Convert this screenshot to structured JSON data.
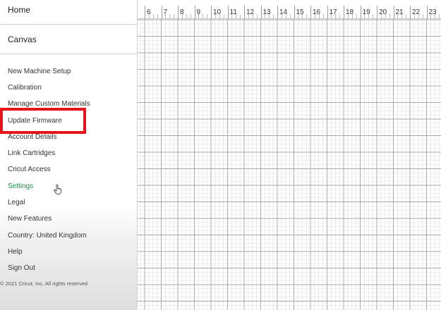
{
  "sidebar": {
    "home": "Home",
    "canvas": "Canvas",
    "items": [
      {
        "label": "New Machine Setup"
      },
      {
        "label": "Calibration"
      },
      {
        "label": "Manage Custom Materials"
      },
      {
        "label": "Update Firmware"
      },
      {
        "label": "Account Details"
      },
      {
        "label": "Link Cartridges"
      },
      {
        "label": "Cricut Access"
      },
      {
        "label": "Settings"
      },
      {
        "label": "Legal"
      },
      {
        "label": "New Features"
      },
      {
        "label": "Country: United Kingdom"
      },
      {
        "label": "Help"
      },
      {
        "label": "Sign Out"
      }
    ],
    "copyright": "© 2021 Cricut, Inc. All rights reserved.",
    "active_color": "#1e8a4c",
    "highlight_color": "#e8141c"
  },
  "canvas": {
    "ruler_numbers": [
      "6",
      "7",
      "8",
      "9",
      "10",
      "11",
      "12",
      "13",
      "14",
      "15",
      "16",
      "17",
      "18",
      "19",
      "20",
      "21",
      "22",
      "23"
    ]
  }
}
